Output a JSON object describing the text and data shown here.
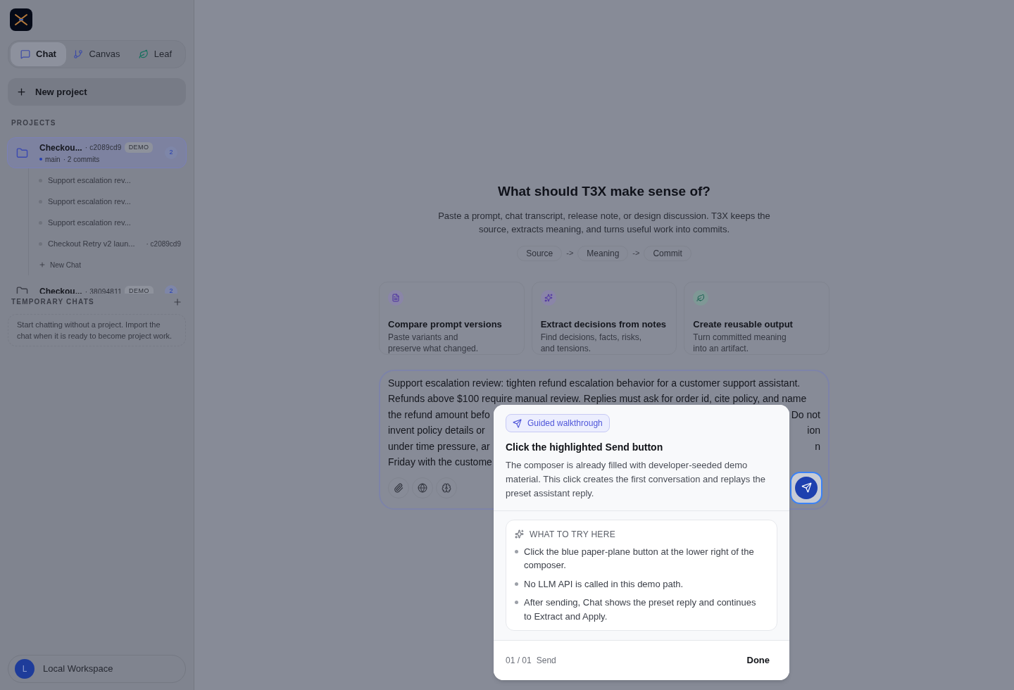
{
  "sidebar": {
    "tabs": [
      {
        "label": "Chat",
        "selected": true
      },
      {
        "label": "Canvas",
        "selected": false
      },
      {
        "label": "Leaf",
        "selected": false
      }
    ],
    "new_project": "New project",
    "projects_heading": "PROJECTS",
    "projects": [
      {
        "name": "Checkou...",
        "commit": "· c2089cd9",
        "badge": "DEMO",
        "count": "2",
        "branch": "main",
        "commits": "· 2 commits",
        "selected": true,
        "chats": [
          {
            "title": "Support escalation rev..."
          },
          {
            "title": "Support escalation rev..."
          },
          {
            "title": "Support escalation rev..."
          },
          {
            "title": "Checkout Retry v2 laun...",
            "commit": "· c2089cd9"
          }
        ],
        "new_chat": "New Chat"
      },
      {
        "name": "Checkou...",
        "commit": "· 38094811",
        "badge": "DEMO",
        "count": "2",
        "selected": false
      }
    ],
    "temporary_heading": "TEMPORARY CHATS",
    "temporary_empty": "Start chatting without a project. Import the chat when it is ready to become project work.",
    "workspace": {
      "initial": "L",
      "name": "Local Workspace"
    }
  },
  "main": {
    "heading": "What should T3X make sense of?",
    "intro": "Paste a prompt, chat transcript, release note, or design discussion. T3X keeps the source, extracts meaning, and turns useful work into commits.",
    "flow": [
      "Source",
      "->",
      "Meaning",
      "->",
      "Commit"
    ],
    "cards": [
      {
        "title": "Compare prompt versions",
        "text": "Paste variants and preserve what changed."
      },
      {
        "title": "Extract decisions from notes",
        "text": "Find decisions, facts, risks, and tensions."
      },
      {
        "title": "Create reusable output",
        "text": "Turn committed meaning into an artifact."
      }
    ],
    "composer": {
      "lines": [
        {
          "left": "Support escalation review: tighten refund escalation behavior for a customer support assistant."
        },
        {
          "left": "Refunds above $100 require manual review. Replies must ask for order id, cite policy, and name"
        },
        {
          "left": "the refund amount befo",
          "right": "Do not"
        },
        {
          "left": "invent policy details or",
          "right": "ion"
        },
        {
          "left": "under time pressure, ar",
          "right": "n"
        },
        {
          "left": "Friday with the custome"
        }
      ]
    }
  },
  "walkthrough": {
    "badge": "Guided walkthrough",
    "title": "Click the highlighted Send button",
    "body": "The composer is already filled with developer-seeded demo material. This click creates the first conversation and replays the preset assistant reply.",
    "tips_heading": "WHAT TO TRY HERE",
    "tips": [
      "Click the blue paper-plane button at the lower right of the composer.",
      "No LLM API is called in this demo path.",
      "After sending, Chat shows the preset reply and continues to Extract and Apply."
    ],
    "step": "01 / 01",
    "step_label": "Send",
    "done": "Done"
  }
}
